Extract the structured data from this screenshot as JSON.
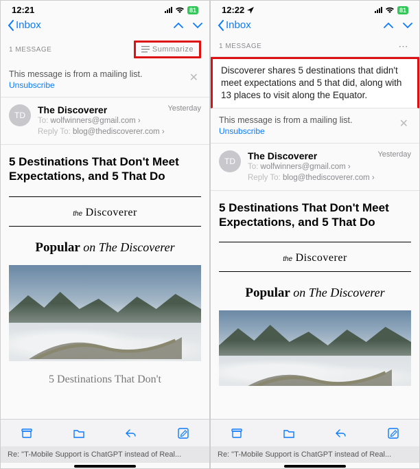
{
  "left": {
    "status": {
      "time": "12:21",
      "battery": "81"
    },
    "nav": {
      "back": "Inbox"
    },
    "header": {
      "count": "1 MESSAGE",
      "summarize": "Summarize"
    },
    "mailing": {
      "text": "This message is from a mailing list.",
      "unsubscribe": "Unsubscribe"
    },
    "sender": {
      "initials": "TD",
      "from": "The Discoverer",
      "to_label": "To:",
      "to": "wolfwinners@gmail.com",
      "reply_label": "Reply To:",
      "reply": "blog@thediscoverer.com",
      "date": "Yesterday"
    },
    "subject": "5 Destinations That Don't Meet Expectations, and 5 That Do",
    "body": {
      "logo_the": "the",
      "logo_name": "Discoverer",
      "popular_p": "Popular ",
      "popular_o": "on The Discoverer",
      "article_title": "5 Destinations That Don't"
    },
    "caption": "Re: \"T-Mobile Support is ChatGPT instead of Real..."
  },
  "right": {
    "status": {
      "time": "12:22",
      "battery": "81"
    },
    "nav": {
      "back": "Inbox"
    },
    "header": {
      "count": "1 MESSAGE"
    },
    "summary": "Discoverer shares 5 destinations that didn't meet expectations and 5 that did, along with 13 places to visit along the Equator.",
    "mailing": {
      "text": "This message is from a mailing list.",
      "unsubscribe": "Unsubscribe"
    },
    "sender": {
      "initials": "TD",
      "from": "The Discoverer",
      "to_label": "To:",
      "to": "wolfwinners@gmail.com",
      "reply_label": "Reply To:",
      "reply": "blog@thediscoverer.com",
      "date": "Yesterday"
    },
    "subject": "5 Destinations That Don't Meet Expectations, and 5 That Do",
    "body": {
      "logo_the": "the",
      "logo_name": "Discoverer",
      "popular_p": "Popular ",
      "popular_o": "on The Discoverer"
    },
    "caption": "Re: \"T-Mobile Support is ChatGPT instead of Real..."
  }
}
